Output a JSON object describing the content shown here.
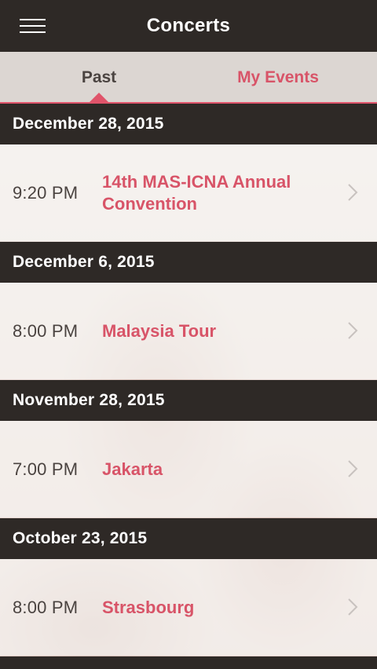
{
  "header": {
    "title": "Concerts",
    "menu_icon": "hamburger-menu-icon"
  },
  "tabs": [
    {
      "label": "Past",
      "active": true
    },
    {
      "label": "My Events",
      "active": false
    }
  ],
  "colors": {
    "accent": "#e0546a",
    "bar": "#2e2926"
  },
  "groups": [
    {
      "date": "December 28, 2015",
      "events": [
        {
          "time": "9:20 PM",
          "title": "14th MAS-ICNA Annual Convention"
        }
      ]
    },
    {
      "date": "December 6, 2015",
      "events": [
        {
          "time": "8:00 PM",
          "title": "Malaysia Tour"
        }
      ]
    },
    {
      "date": "November 28, 2015",
      "events": [
        {
          "time": "7:00 PM",
          "title": "Jakarta"
        }
      ]
    },
    {
      "date": "October 23, 2015",
      "events": [
        {
          "time": "8:00 PM",
          "title": "Strasbourg"
        }
      ]
    }
  ]
}
